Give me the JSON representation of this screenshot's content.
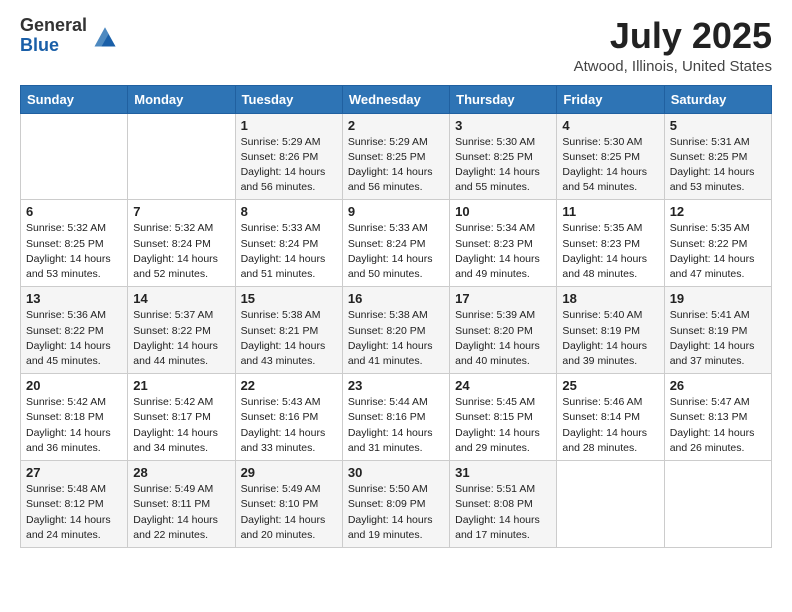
{
  "header": {
    "logo_general": "General",
    "logo_blue": "Blue",
    "title": "July 2025",
    "location": "Atwood, Illinois, United States"
  },
  "weekdays": [
    "Sunday",
    "Monday",
    "Tuesday",
    "Wednesday",
    "Thursday",
    "Friday",
    "Saturday"
  ],
  "weeks": [
    [
      {
        "day": "",
        "info": ""
      },
      {
        "day": "",
        "info": ""
      },
      {
        "day": "1",
        "info": "Sunrise: 5:29 AM\nSunset: 8:26 PM\nDaylight: 14 hours and 56 minutes."
      },
      {
        "day": "2",
        "info": "Sunrise: 5:29 AM\nSunset: 8:25 PM\nDaylight: 14 hours and 56 minutes."
      },
      {
        "day": "3",
        "info": "Sunrise: 5:30 AM\nSunset: 8:25 PM\nDaylight: 14 hours and 55 minutes."
      },
      {
        "day": "4",
        "info": "Sunrise: 5:30 AM\nSunset: 8:25 PM\nDaylight: 14 hours and 54 minutes."
      },
      {
        "day": "5",
        "info": "Sunrise: 5:31 AM\nSunset: 8:25 PM\nDaylight: 14 hours and 53 minutes."
      }
    ],
    [
      {
        "day": "6",
        "info": "Sunrise: 5:32 AM\nSunset: 8:25 PM\nDaylight: 14 hours and 53 minutes."
      },
      {
        "day": "7",
        "info": "Sunrise: 5:32 AM\nSunset: 8:24 PM\nDaylight: 14 hours and 52 minutes."
      },
      {
        "day": "8",
        "info": "Sunrise: 5:33 AM\nSunset: 8:24 PM\nDaylight: 14 hours and 51 minutes."
      },
      {
        "day": "9",
        "info": "Sunrise: 5:33 AM\nSunset: 8:24 PM\nDaylight: 14 hours and 50 minutes."
      },
      {
        "day": "10",
        "info": "Sunrise: 5:34 AM\nSunset: 8:23 PM\nDaylight: 14 hours and 49 minutes."
      },
      {
        "day": "11",
        "info": "Sunrise: 5:35 AM\nSunset: 8:23 PM\nDaylight: 14 hours and 48 minutes."
      },
      {
        "day": "12",
        "info": "Sunrise: 5:35 AM\nSunset: 8:22 PM\nDaylight: 14 hours and 47 minutes."
      }
    ],
    [
      {
        "day": "13",
        "info": "Sunrise: 5:36 AM\nSunset: 8:22 PM\nDaylight: 14 hours and 45 minutes."
      },
      {
        "day": "14",
        "info": "Sunrise: 5:37 AM\nSunset: 8:22 PM\nDaylight: 14 hours and 44 minutes."
      },
      {
        "day": "15",
        "info": "Sunrise: 5:38 AM\nSunset: 8:21 PM\nDaylight: 14 hours and 43 minutes."
      },
      {
        "day": "16",
        "info": "Sunrise: 5:38 AM\nSunset: 8:20 PM\nDaylight: 14 hours and 41 minutes."
      },
      {
        "day": "17",
        "info": "Sunrise: 5:39 AM\nSunset: 8:20 PM\nDaylight: 14 hours and 40 minutes."
      },
      {
        "day": "18",
        "info": "Sunrise: 5:40 AM\nSunset: 8:19 PM\nDaylight: 14 hours and 39 minutes."
      },
      {
        "day": "19",
        "info": "Sunrise: 5:41 AM\nSunset: 8:19 PM\nDaylight: 14 hours and 37 minutes."
      }
    ],
    [
      {
        "day": "20",
        "info": "Sunrise: 5:42 AM\nSunset: 8:18 PM\nDaylight: 14 hours and 36 minutes."
      },
      {
        "day": "21",
        "info": "Sunrise: 5:42 AM\nSunset: 8:17 PM\nDaylight: 14 hours and 34 minutes."
      },
      {
        "day": "22",
        "info": "Sunrise: 5:43 AM\nSunset: 8:16 PM\nDaylight: 14 hours and 33 minutes."
      },
      {
        "day": "23",
        "info": "Sunrise: 5:44 AM\nSunset: 8:16 PM\nDaylight: 14 hours and 31 minutes."
      },
      {
        "day": "24",
        "info": "Sunrise: 5:45 AM\nSunset: 8:15 PM\nDaylight: 14 hours and 29 minutes."
      },
      {
        "day": "25",
        "info": "Sunrise: 5:46 AM\nSunset: 8:14 PM\nDaylight: 14 hours and 28 minutes."
      },
      {
        "day": "26",
        "info": "Sunrise: 5:47 AM\nSunset: 8:13 PM\nDaylight: 14 hours and 26 minutes."
      }
    ],
    [
      {
        "day": "27",
        "info": "Sunrise: 5:48 AM\nSunset: 8:12 PM\nDaylight: 14 hours and 24 minutes."
      },
      {
        "day": "28",
        "info": "Sunrise: 5:49 AM\nSunset: 8:11 PM\nDaylight: 14 hours and 22 minutes."
      },
      {
        "day": "29",
        "info": "Sunrise: 5:49 AM\nSunset: 8:10 PM\nDaylight: 14 hours and 20 minutes."
      },
      {
        "day": "30",
        "info": "Sunrise: 5:50 AM\nSunset: 8:09 PM\nDaylight: 14 hours and 19 minutes."
      },
      {
        "day": "31",
        "info": "Sunrise: 5:51 AM\nSunset: 8:08 PM\nDaylight: 14 hours and 17 minutes."
      },
      {
        "day": "",
        "info": ""
      },
      {
        "day": "",
        "info": ""
      }
    ]
  ]
}
